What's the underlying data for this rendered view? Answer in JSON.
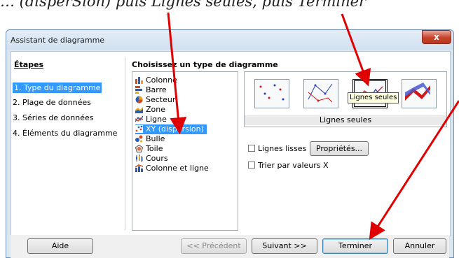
{
  "caption": "… (disperSion) puis Lignes seules, puis Terminer",
  "window": {
    "title": "Assistant de diagramme",
    "close_label": "x"
  },
  "steps": {
    "title": "Étapes",
    "items": [
      {
        "label": "1. Type du diagramme",
        "selected": true
      },
      {
        "label": "2. Plage de données",
        "selected": false
      },
      {
        "label": "3. Séries de données",
        "selected": false
      },
      {
        "label": "4. Éléments du diagramme",
        "selected": false
      }
    ]
  },
  "chart_types": {
    "title": "Choisissez un type de diagramme",
    "items": [
      {
        "label": "Colonne",
        "icon": "column-chart-icon",
        "selected": false
      },
      {
        "label": "Barre",
        "icon": "bar-chart-icon",
        "selected": false
      },
      {
        "label": "Secteur",
        "icon": "pie-chart-icon",
        "selected": false
      },
      {
        "label": "Zone",
        "icon": "area-chart-icon",
        "selected": false
      },
      {
        "label": "Ligne",
        "icon": "line-chart-icon",
        "selected": false
      },
      {
        "label": "XY (dispersion)",
        "icon": "scatter-chart-icon",
        "selected": true
      },
      {
        "label": "Bulle",
        "icon": "bubble-chart-icon",
        "selected": false
      },
      {
        "label": "Toile",
        "icon": "net-chart-icon",
        "selected": false
      },
      {
        "label": "Cours",
        "icon": "stock-chart-icon",
        "selected": false
      },
      {
        "label": "Colonne et ligne",
        "icon": "column-line-chart-icon",
        "selected": false
      }
    ]
  },
  "variants": {
    "selected_label": "Lignes seules",
    "tooltip": "Lignes seules",
    "items": [
      "points-only",
      "points-and-lines",
      "lines-only",
      "3d-lines"
    ]
  },
  "options": {
    "smooth_lines": {
      "label": "Lignes lisses",
      "checked": false
    },
    "properties_label": "Propriétés...",
    "sort_by_x": {
      "label": "Trier par valeurs X",
      "checked": false
    }
  },
  "buttons": {
    "help": "Aide",
    "previous": "<< Précédent",
    "next": "Suivant >>",
    "finish": "Terminer",
    "cancel": "Annuler"
  },
  "colors": {
    "selection": "#3399ff",
    "arrow": "#e00000"
  }
}
